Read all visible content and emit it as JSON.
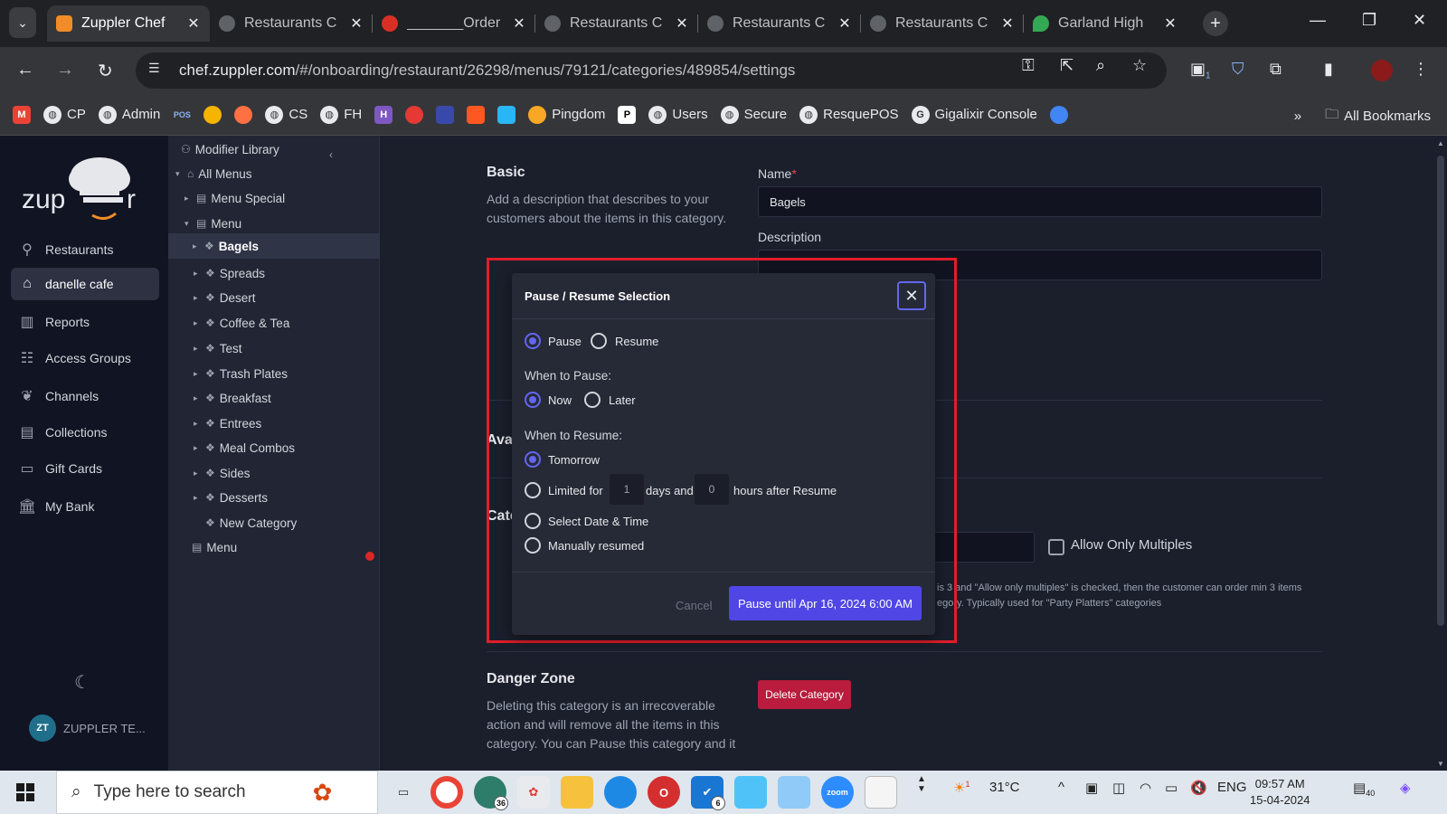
{
  "browser": {
    "tabs": [
      {
        "title": "Zuppler Chef",
        "active": true,
        "favicon": "chef-hat-icon"
      },
      {
        "title": "Restaurants C",
        "active": false,
        "favicon": "globe-icon"
      },
      {
        "title": "_______Order",
        "active": false,
        "favicon": "red-logo-icon"
      },
      {
        "title": "Restaurants C",
        "active": false,
        "favicon": "globe-icon"
      },
      {
        "title": "Restaurants C",
        "active": false,
        "favicon": "globe-icon"
      },
      {
        "title": "Restaurants C",
        "active": false,
        "favicon": "globe-icon"
      },
      {
        "title": "Garland High",
        "active": false,
        "favicon": "maps-icon"
      }
    ],
    "url_host": "chef.zuppler.com",
    "url_path": "/#/onboarding/restaurant/26298/menus/79121/categories/489854/settings",
    "extension_badge": "1",
    "bookmarks": [
      {
        "label": "CP",
        "icon": "globe-icon"
      },
      {
        "label": "Admin",
        "icon": "globe-icon"
      },
      {
        "label": "",
        "icon": "pos-icon"
      },
      {
        "label": "",
        "icon": "app-icon"
      },
      {
        "label": "",
        "icon": "app-icon"
      },
      {
        "label": "CS",
        "icon": "globe-icon"
      },
      {
        "label": "FH",
        "icon": "globe-icon"
      },
      {
        "label": "",
        "icon": "app-icon"
      },
      {
        "label": "",
        "icon": "app-icon"
      },
      {
        "label": "",
        "icon": "app-icon"
      },
      {
        "label": "",
        "icon": "app-icon"
      },
      {
        "label": "",
        "icon": "app-icon"
      },
      {
        "label": "Pingdom",
        "icon": "pingdom-icon"
      },
      {
        "label": "",
        "icon": "app-icon"
      },
      {
        "label": "Users",
        "icon": "globe-icon"
      },
      {
        "label": "Secure",
        "icon": "globe-icon"
      },
      {
        "label": "ResquePOS",
        "icon": "globe-icon"
      },
      {
        "label": "Gigalixir Console",
        "icon": "google-icon"
      }
    ],
    "all_bookmarks": "All Bookmarks"
  },
  "sidebar": {
    "items": [
      {
        "label": "Restaurants",
        "icon": "fork-knife-icon",
        "active": false
      },
      {
        "label": "danelle cafe",
        "icon": "home-icon",
        "active": true
      },
      {
        "label": "Reports",
        "icon": "chart-icon",
        "active": false
      },
      {
        "label": "Access Groups",
        "icon": "people-icon",
        "active": false
      },
      {
        "label": "Channels",
        "icon": "leaf-icon",
        "active": false
      },
      {
        "label": "Collections",
        "icon": "images-icon",
        "active": false
      },
      {
        "label": "Gift Cards",
        "icon": "card-icon",
        "active": false
      },
      {
        "label": "My Bank",
        "icon": "bank-icon",
        "active": false
      }
    ],
    "user_initials": "ZT",
    "user_name": "ZUPPLER TE..."
  },
  "tree": {
    "items": [
      {
        "label": "Modifier Library"
      },
      {
        "label": "All Menus"
      },
      {
        "label": "Menu Special"
      },
      {
        "label": "Menu"
      },
      {
        "label": "Bagels",
        "selected": true
      },
      {
        "label": "Spreads"
      },
      {
        "label": "Desert"
      },
      {
        "label": "Coffee & Tea"
      },
      {
        "label": "Test"
      },
      {
        "label": "Trash Plates"
      },
      {
        "label": "Breakfast"
      },
      {
        "label": "Entrees"
      },
      {
        "label": "Meal Combos"
      },
      {
        "label": "Sides"
      },
      {
        "label": "Desserts"
      },
      {
        "label": "New Category"
      },
      {
        "label": "Menu"
      }
    ]
  },
  "main": {
    "basic_title": "Basic",
    "basic_desc": "Add a description that describes to your customers about the items in this category.",
    "name_label": "Name",
    "name_required": "*",
    "name_value": "Bagels",
    "description_label": "Description",
    "availability_partial": "Ava",
    "category_partial": "Cate",
    "allow_multiples_label": "Allow Only Multiples",
    "multiples_help_1": "is 3 and \"Allow only multiples\" is checked, then the customer can order min 3 items",
    "multiples_help_2": "egory. Typically used for \"Party Platters\" categories",
    "danger_title": "Danger Zone",
    "danger_desc": "Deleting this category is an irrecoverable action and will remove all the items in this category. You can Pause this category and it",
    "delete_button": "Delete Category"
  },
  "modal": {
    "title": "Pause / Resume Selection",
    "mode_options": [
      "Pause",
      "Resume"
    ],
    "mode_selected": "Pause",
    "when_pause_label": "When to Pause:",
    "pause_options": [
      "Now",
      "Later"
    ],
    "pause_selected": "Now",
    "when_resume_label": "When to Resume:",
    "resume_tomorrow": "Tomorrow",
    "resume_limited_prefix": "Limited for",
    "resume_days_value": "1",
    "resume_days_label": "days and",
    "resume_hours_value": "0",
    "resume_hours_label": "hours after Resume",
    "resume_select_date": "Select Date & Time",
    "resume_manual": "Manually resumed",
    "resume_selected": "Tomorrow",
    "cancel_label": "Cancel",
    "confirm_label": "Pause until Apr 16, 2024 6:00 AM",
    "accent_color": "#4f46e5",
    "highlight_color": "#e11d2a"
  },
  "taskbar": {
    "search_placeholder": "Type here to search",
    "badge_36": "36",
    "badge_6": "6",
    "weather_badge": "1",
    "temperature": "31°C",
    "language": "ENG",
    "time": "09:57 AM",
    "date": "15-04-2024",
    "notifications": "40"
  }
}
